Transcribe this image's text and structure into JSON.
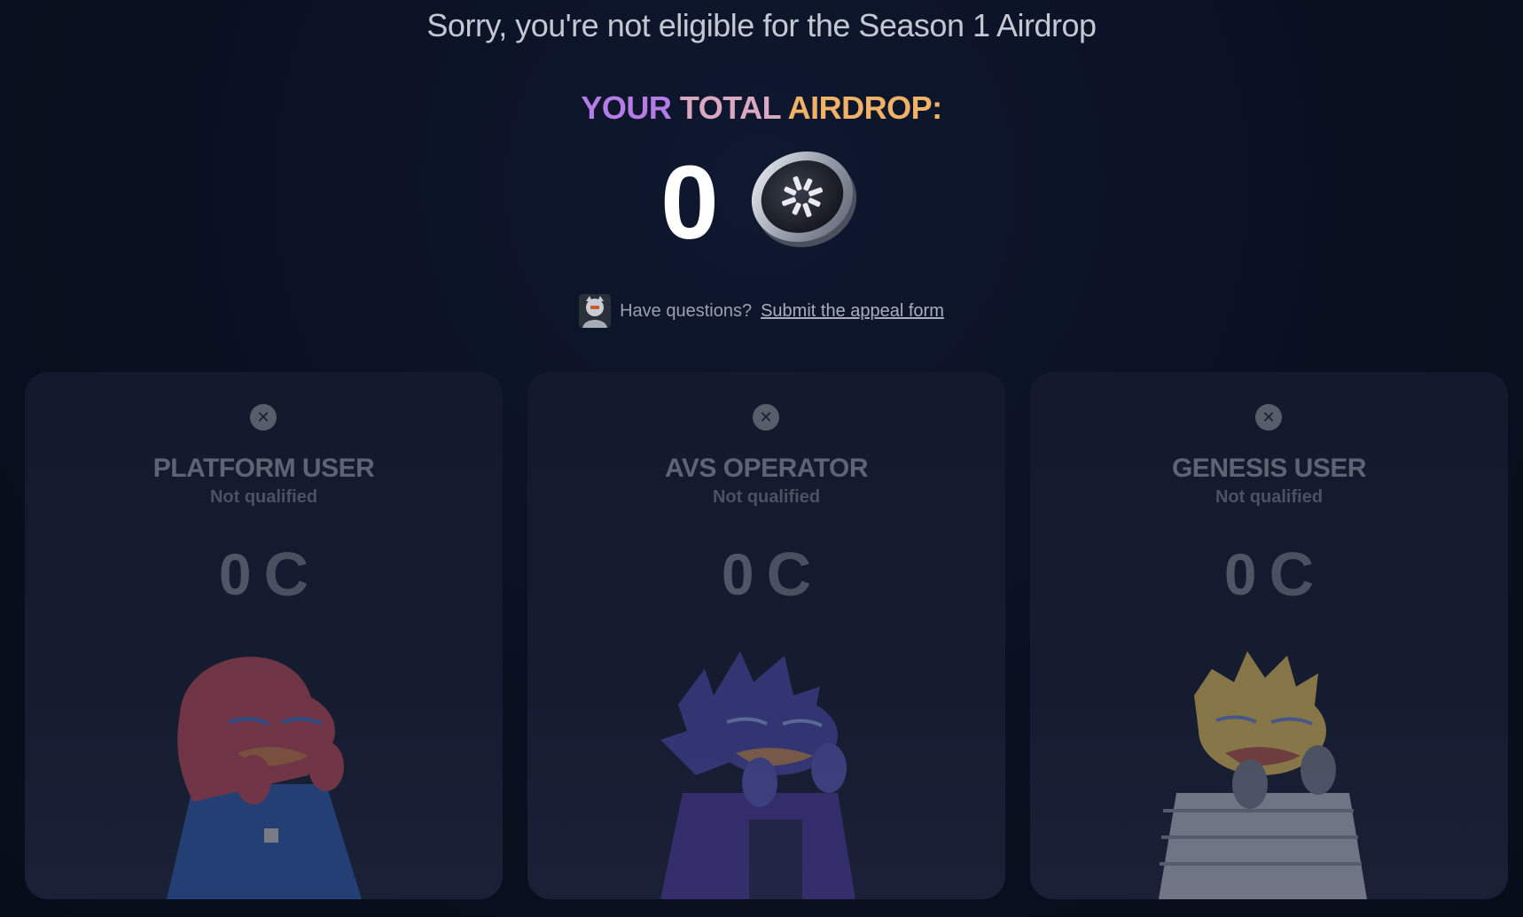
{
  "headline": "Sorry, you're not eligible for the Season 1 Airdrop",
  "total": {
    "label_part1": "YOUR",
    "label_part2": "TOTAL",
    "label_part3": "AIRDROP:",
    "value": "0",
    "coin_icon": "airdrop-coin-icon"
  },
  "questions": {
    "text": "Have questions?",
    "link": "Submit the appeal form"
  },
  "cards": [
    {
      "title": "PLATFORM USER",
      "status": "Not qualified",
      "amount": "0",
      "currency": "C",
      "art_color": "#b84a58"
    },
    {
      "title": "AVS OPERATOR",
      "status": "Not qualified",
      "amount": "0",
      "currency": "C",
      "art_color": "#4a4aa8"
    },
    {
      "title": "GENESIS USER",
      "status": "Not qualified",
      "amount": "0",
      "currency": "C",
      "art_color": "#e3c05a"
    }
  ],
  "colors": {
    "background": "#0a1020",
    "card": "#141a2c",
    "accent_purple": "#b57be6",
    "accent_orange": "#f0b266"
  }
}
